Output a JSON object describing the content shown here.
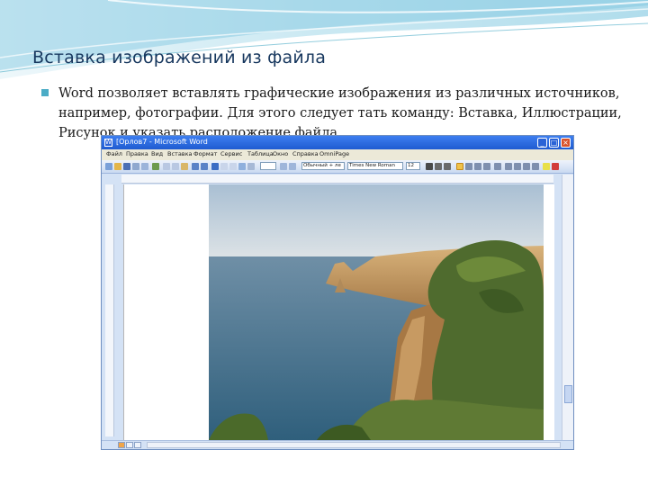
{
  "slide": {
    "title": "Вставка изображений из файла",
    "body": "Word позволяет вставлять графические изображения  из различных источников, например, фотографии. Для этого следует тать команду: Вставка, Иллюстрации, Рисунок и указать расположение файла.",
    "accent_color": "#4bacc6",
    "title_color": "#17375e"
  },
  "word_window": {
    "title": "[Орлов7 - Microsoft Word",
    "menu": [
      "Файл",
      "Правка",
      "Вид",
      "Вставка",
      "Формат",
      "Сервис",
      "Таблица",
      "Окно",
      "Справка",
      "OmniPage"
    ],
    "style_value": "Обычный + ле",
    "font_value": "Times New Roman",
    "size_value": "12",
    "icons": [
      "minimize-icon",
      "maximize-icon",
      "close-icon"
    ]
  },
  "image": {
    "description_icon": "coastal-landscape-photo"
  }
}
